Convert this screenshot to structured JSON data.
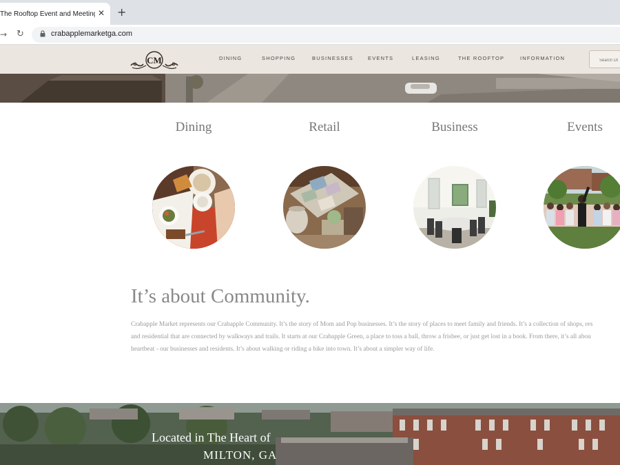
{
  "browser": {
    "tab_title": "The Rooftop Event and Meeting Spa",
    "url": "crabapplemarketga.com"
  },
  "site": {
    "logo_letters": "CM",
    "nav": [
      "DINING",
      "SHOPPING",
      "BUSINESSES",
      "EVENTS",
      "LEASING",
      "THE ROOFTOP",
      "INFORMATION"
    ],
    "search_placeholder": "Search Ot"
  },
  "categories": [
    {
      "title": "Dining",
      "icon": "dining-photo"
    },
    {
      "title": "Retail",
      "icon": "retail-photo"
    },
    {
      "title": "Business",
      "icon": "business-photo"
    },
    {
      "title": "Events",
      "icon": "events-photo"
    }
  ],
  "community": {
    "heading": "It’s about Community.",
    "lines": [
      "Crabapple Market represents our Crabapple Community. It’s the story of Mom and Pop businesses. It’s the story of places to meet family and friends. It’s a collection of shops, res",
      "and residential that are connected by walkways and trails. It starts at our Crabapple Green, a place to toss a ball, throw a frisbee, or just get lost in a book. From there, it’s all abou",
      "heartbeat - our businesses and residents. It’s about walking or riding a bike into town. It’s about a simpler way of life."
    ]
  },
  "location": {
    "line1": "Located in The Heart of",
    "line2": "MILTON, GA"
  },
  "colors": {
    "header_bg": "#ece6e0",
    "text_gray": "#777777"
  }
}
